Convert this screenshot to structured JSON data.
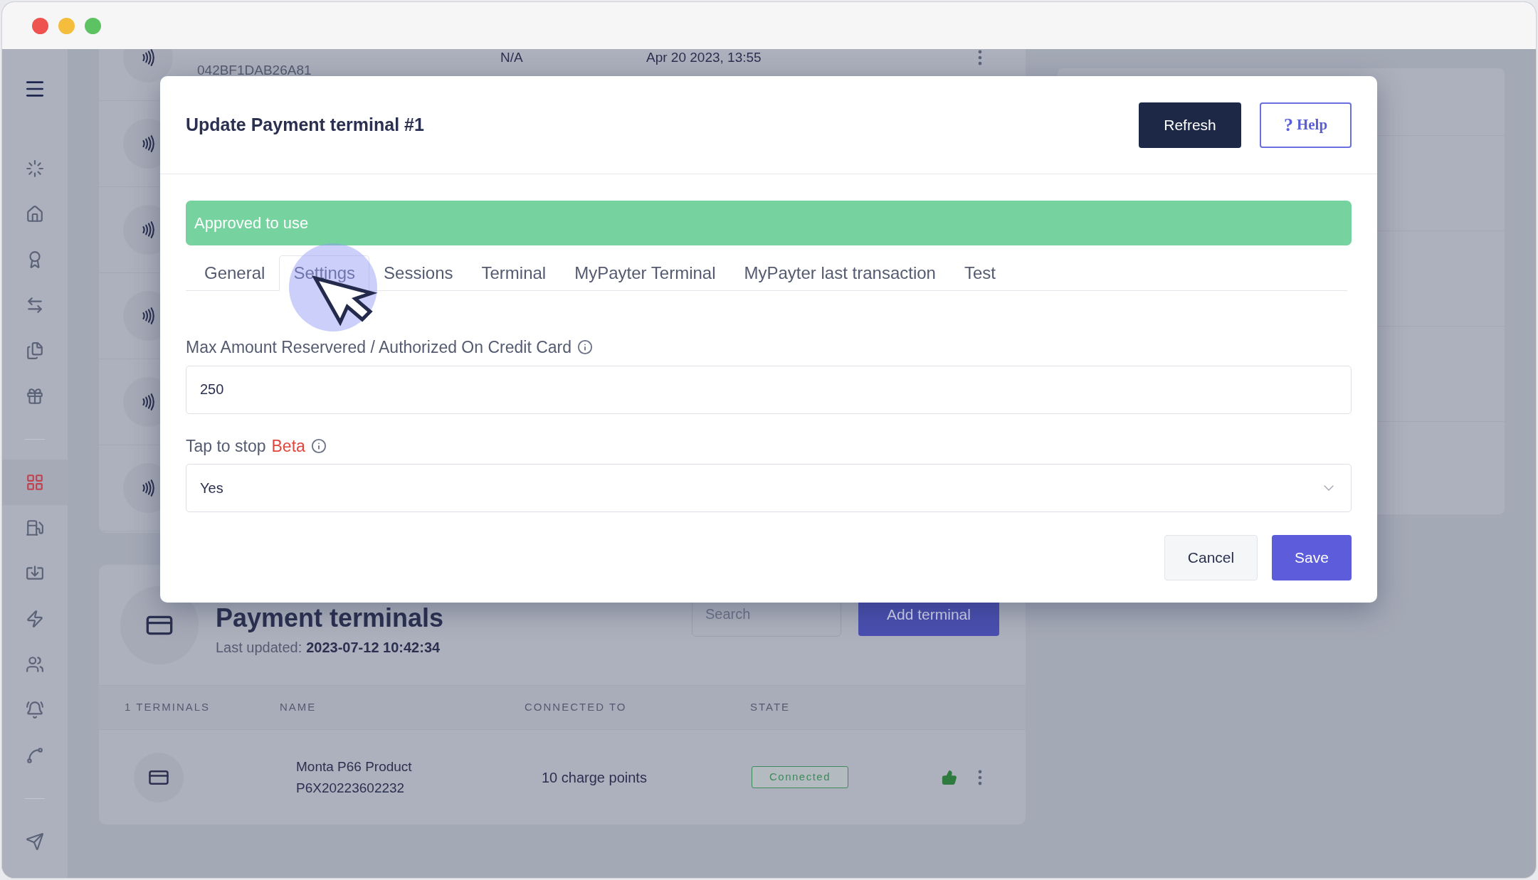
{
  "sidebar": {
    "groups": [
      {
        "items": [
          {
            "selected": false
          },
          {
            "selected": false
          },
          {
            "selected": false
          },
          {
            "selected": false
          },
          {
            "selected": false
          },
          {
            "selected": false
          }
        ]
      },
      {
        "items": [
          {
            "selected": true
          },
          {
            "selected": false
          },
          {
            "selected": false
          },
          {
            "selected": false
          },
          {
            "selected": false
          },
          {
            "selected": false
          },
          {
            "selected": false
          }
        ]
      },
      {
        "items": [
          {
            "selected": false
          }
        ]
      }
    ]
  },
  "background_list": {
    "rows": [
      {
        "code": "042BF1DAB26A81",
        "connected_to": "N/A",
        "date": "Apr 20 2023, 13:55"
      }
    ]
  },
  "payment_terminals": {
    "title": "Payment terminals",
    "updated_label": "Last updated:",
    "updated_value": "2023-07-12 10:42:34",
    "search": {
      "placeholder": "Search"
    },
    "add_button": "Add terminal",
    "columns": [
      "1 TERMINALS",
      "NAME",
      "CONNECTED TO",
      "STATE"
    ],
    "rows": [
      {
        "name": "Monta P66 Product",
        "serial": "P6X20223602232",
        "connected_to": "10 charge points",
        "state": "Connected",
        "approved": true
      }
    ]
  },
  "modal": {
    "title": "Update Payment terminal #1",
    "header_buttons": [
      {
        "kind": "primary",
        "label": "Refresh"
      },
      {
        "kind": "help",
        "icon_text": "?",
        "label": "Help"
      }
    ],
    "status": "Approved to use",
    "tabs": [
      {
        "label": "General",
        "selected": false
      },
      {
        "label": "Settings",
        "selected": true
      },
      {
        "label": "Sessions",
        "selected": false
      },
      {
        "label": "Terminal",
        "selected": false
      },
      {
        "label": "MyPayter Terminal",
        "selected": false
      },
      {
        "label": "MyPayter last transaction",
        "selected": false
      },
      {
        "label": "Test",
        "selected": false
      }
    ],
    "fields": [
      {
        "kind": "input",
        "label": "Max Amount Reservered / Authorized On Credit Card",
        "value": "250"
      },
      {
        "kind": "select",
        "label": "Tap to stop",
        "badge": "Beta",
        "value": "Yes"
      }
    ],
    "actions": [
      {
        "kind": "secondary",
        "label": "Cancel"
      },
      {
        "kind": "primary",
        "label": "Save"
      }
    ]
  }
}
